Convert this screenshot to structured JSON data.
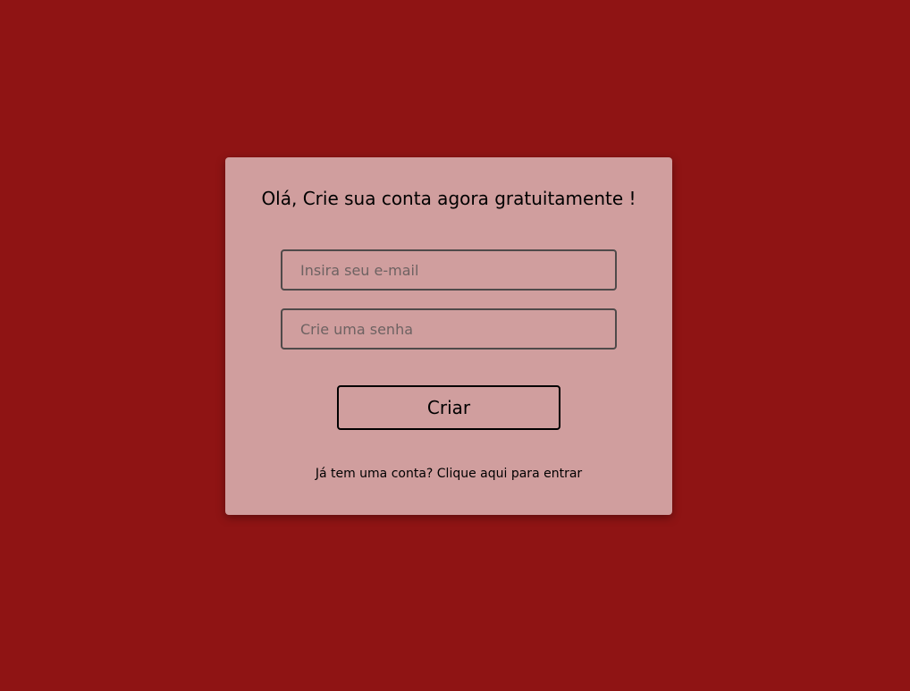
{
  "colors": {
    "background": "#8f1414",
    "card": "#d09e9e",
    "field_border": "#4f4a4a",
    "text": "#000000"
  },
  "signup": {
    "title": "Olá, Crie sua conta agora gratuitamente !",
    "email_placeholder": "Insira seu e-mail",
    "email_value": "",
    "password_placeholder": "Crie uma senha",
    "password_value": "",
    "submit_label": "Criar",
    "login_link": "Já tem uma conta? Clique aqui para entrar"
  }
}
